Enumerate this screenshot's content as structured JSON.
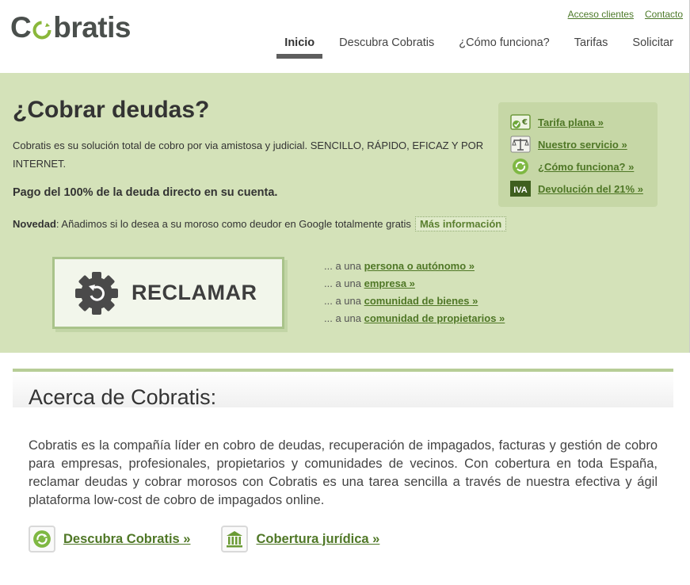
{
  "header": {
    "logo_text_left": "C",
    "logo_text_right": "bratis",
    "top_links": {
      "clientes": "Acceso clientes",
      "contacto": "Contacto"
    },
    "nav": {
      "inicio": "Inicio",
      "descubra": "Descubra Cobratis",
      "como": "¿Cómo funciona?",
      "tarifas": "Tarifas",
      "solicitar": "Solicitar"
    }
  },
  "hero": {
    "title": "¿Cobrar deudas?",
    "intro": "Cobratis es su solución total de cobro por via amistosa y judicial. SENCILLO, RÁPIDO, EFICAZ Y POR INTERNET.",
    "pago": "Pago del 100% de la deuda directo en su cuenta.",
    "novedad_label": "Novedad",
    "novedad_text": ": Añadimos si lo desea a su moroso como deudor en Google totalmente gratis",
    "mas_info": "Más información",
    "side_links": {
      "tarifa": "Tarifa plana »",
      "servicio": "Nuestro servicio »",
      "como": "¿Cómo funciona? »",
      "iva_badge": "IVA",
      "devolucion": "Devolución del 21% »"
    },
    "reclamar": "RECLAMAR",
    "targets": {
      "prefix": "... a una ",
      "persona": "persona o autónomo »",
      "empresa": "empresa »",
      "comunidad_bienes": "comunidad de bienes »",
      "comunidad_propietarios": "comunidad de propietarios »"
    }
  },
  "about": {
    "title": "Acerca de Cobratis:",
    "text": "Cobratis es la compañía líder en cobro de deudas, recuperación de impagados, facturas y gestión de cobro para empresas, profesionales, propietarios y comunidades de vecinos. Con cobertura en toda España, reclamar deudas y cobrar morosos con Cobratis es una tarea sencilla a través de nuestra efectiva y ágil plataforma low-cost de cobro de impagados online.",
    "link_descubra": "Descubra Cobratis »",
    "link_cobertura": "Cobertura jurídica »"
  },
  "colors": {
    "accent_green": "#4f7726",
    "hero_bg": "#d4e2b9",
    "box_bg": "#c6d7a6",
    "nav_active": "#5e5e5e"
  },
  "icons": [
    "euro-check-icon",
    "scales-icon",
    "refresh-leaf-icon",
    "iva-badge-icon",
    "gear-refresh-icon",
    "courthouse-icon"
  ]
}
